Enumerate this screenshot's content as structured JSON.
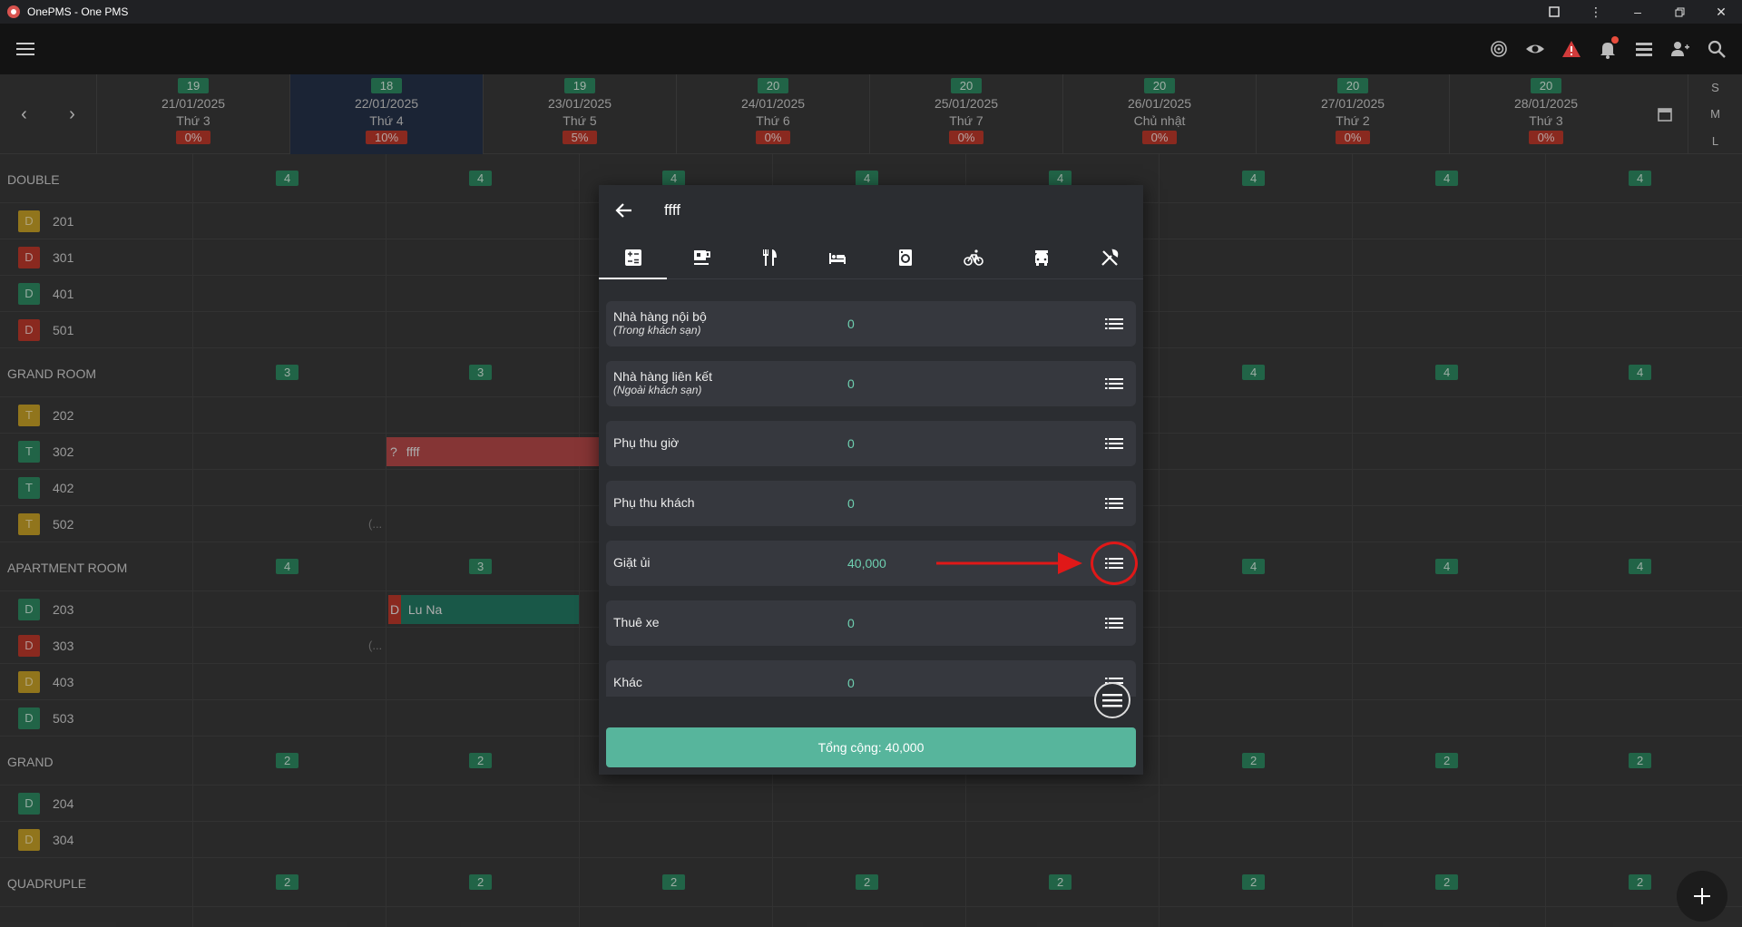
{
  "window": {
    "title": "OnePMS - One PMS"
  },
  "header": {
    "days": [
      {
        "avail": "19",
        "date": "21/01/2025",
        "weekday": "Thứ 3",
        "occ": "0%"
      },
      {
        "avail": "18",
        "date": "22/01/2025",
        "weekday": "Thứ 4",
        "occ": "10%"
      },
      {
        "avail": "19",
        "date": "23/01/2025",
        "weekday": "Thứ 5",
        "occ": "5%"
      },
      {
        "avail": "20",
        "date": "24/01/2025",
        "weekday": "Thứ 6",
        "occ": "0%"
      },
      {
        "avail": "20",
        "date": "25/01/2025",
        "weekday": "Thứ 7",
        "occ": "0%"
      },
      {
        "avail": "20",
        "date": "26/01/2025",
        "weekday": "Chủ nhật",
        "occ": "0%"
      },
      {
        "avail": "20",
        "date": "27/01/2025",
        "weekday": "Thứ 2",
        "occ": "0%"
      },
      {
        "avail": "20",
        "date": "28/01/2025",
        "weekday": "Thứ 3",
        "occ": "0%"
      }
    ],
    "view_sizes": [
      "S",
      "M",
      "L"
    ],
    "prev": "‹",
    "next": "›"
  },
  "grid": {
    "categories": [
      {
        "name": "DOUBLE",
        "counts": [
          "4",
          "4",
          "4",
          "4",
          "4",
          "4",
          "4",
          "4"
        ]
      },
      {
        "name": "GRAND ROOM",
        "counts": [
          "3",
          "3",
          "",
          "",
          "",
          "4",
          "4",
          "4"
        ]
      },
      {
        "name": "APARTMENT ROOM",
        "counts": [
          "4",
          "3",
          "",
          "",
          "",
          "4",
          "4",
          "4"
        ]
      },
      {
        "name": "GRAND",
        "counts": [
          "2",
          "2",
          "",
          "",
          "",
          "2",
          "2",
          "2"
        ]
      },
      {
        "name": "QUADRUPLE",
        "counts": [
          "2",
          "2",
          "2",
          "2",
          "2",
          "2",
          "2",
          "2"
        ]
      }
    ],
    "rooms": [
      {
        "type": "D",
        "color": "y",
        "num": "201"
      },
      {
        "type": "D",
        "color": "r",
        "num": "301"
      },
      {
        "type": "D",
        "color": "g",
        "num": "401"
      },
      {
        "type": "D",
        "color": "r",
        "num": "501"
      },
      {
        "type": "T",
        "color": "y",
        "num": "202"
      },
      {
        "type": "T",
        "color": "g",
        "num": "302"
      },
      {
        "type": "T",
        "color": "g",
        "num": "402"
      },
      {
        "type": "T",
        "color": "y",
        "num": "502"
      },
      {
        "type": "D",
        "color": "g",
        "num": "203"
      },
      {
        "type": "D",
        "color": "r",
        "num": "303"
      },
      {
        "type": "D",
        "color": "y",
        "num": "403"
      },
      {
        "type": "D",
        "color": "g",
        "num": "503"
      },
      {
        "type": "D",
        "color": "g",
        "num": "204"
      },
      {
        "type": "D",
        "color": "y",
        "num": "304"
      }
    ],
    "bookings": {
      "b302": {
        "prefix": "?",
        "name": "ffff"
      },
      "b203": {
        "prefix": "D",
        "name": "Lu Na"
      }
    },
    "paren": "(..."
  },
  "dialog": {
    "title": "ffff",
    "items": [
      {
        "name": "Nhà hàng nội bộ",
        "sub": "(Trong khách sạn)",
        "value": "0"
      },
      {
        "name": "Nhà hàng liên kết",
        "sub": "(Ngoài khách sạn)",
        "value": "0"
      },
      {
        "name": "Phụ thu giờ",
        "sub": "",
        "value": "0"
      },
      {
        "name": "Phụ thu khách",
        "sub": "",
        "value": "0"
      },
      {
        "name": "Giặt ủi",
        "sub": "",
        "value": "40,000"
      },
      {
        "name": "Thuê xe",
        "sub": "",
        "value": "0"
      },
      {
        "name": "Khác",
        "sub": "",
        "value": "0"
      }
    ],
    "total": "Tổng cộng: 40,000"
  },
  "icons": {
    "tabs": [
      "calculator-icon",
      "coffee-icon",
      "restaurant-icon",
      "bed-icon",
      "laundry-icon",
      "bicycle-icon",
      "car-icon",
      "tools-icon"
    ]
  },
  "colors": {
    "accent": "#57b59c",
    "available": "#2e8b63",
    "occupancy": "#c0392b",
    "annotation": "#e01818"
  }
}
